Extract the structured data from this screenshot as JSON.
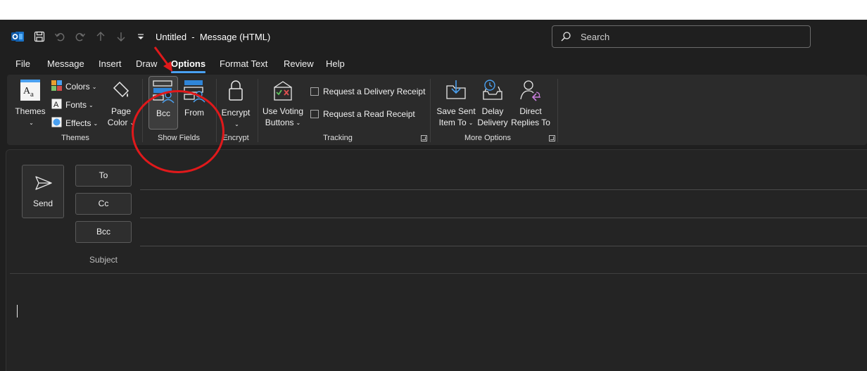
{
  "window": {
    "title": "Untitled  -  Message (HTML)",
    "search_placeholder": "Search"
  },
  "quick_access": {
    "icons": [
      "outlook-app-icon",
      "save-icon",
      "undo-icon",
      "redo-icon",
      "up-arrow-icon",
      "down-arrow-icon",
      "customize-qat-icon"
    ]
  },
  "tabs": [
    {
      "label": "File",
      "active": false
    },
    {
      "label": "Message",
      "active": false
    },
    {
      "label": "Insert",
      "active": false
    },
    {
      "label": "Draw",
      "active": false
    },
    {
      "label": "Options",
      "active": true
    },
    {
      "label": "Format Text",
      "active": false
    },
    {
      "label": "Review",
      "active": false
    },
    {
      "label": "Help",
      "active": false
    }
  ],
  "ribbon": {
    "themes_group": {
      "label": "Themes",
      "themes_button": "Themes",
      "colors": "Colors",
      "fonts": "Fonts",
      "effects": "Effects",
      "page_color_line1": "Page",
      "page_color_line2": "Color"
    },
    "show_fields_group": {
      "label": "Show Fields",
      "bcc": "Bcc",
      "from": "From",
      "bcc_selected": true
    },
    "encrypt_group": {
      "label": "Encrypt",
      "encrypt": "Encrypt"
    },
    "tracking_group": {
      "label": "Tracking",
      "voting_line1": "Use Voting",
      "voting_line2": "Buttons",
      "delivery_receipt": "Request a Delivery Receipt",
      "read_receipt": "Request a Read Receipt",
      "delivery_checked": false,
      "read_checked": false
    },
    "more_options_group": {
      "label": "More Options",
      "save_sent_line1": "Save Sent",
      "save_sent_line2": "Item To",
      "delay_line1": "Delay",
      "delay_line2": "Delivery",
      "direct_line1": "Direct",
      "direct_line2": "Replies To"
    }
  },
  "compose": {
    "send": "Send",
    "to": "To",
    "cc": "Cc",
    "bcc": "Bcc",
    "subject": "Subject",
    "to_value": "",
    "cc_value": "",
    "bcc_value": "",
    "subject_value": "",
    "body_value": ""
  },
  "colors": {
    "background": "#1f1f1f",
    "ribbon": "#2b2b2b",
    "accent": "#4aa0f0",
    "annotation": "#e0191b"
  }
}
